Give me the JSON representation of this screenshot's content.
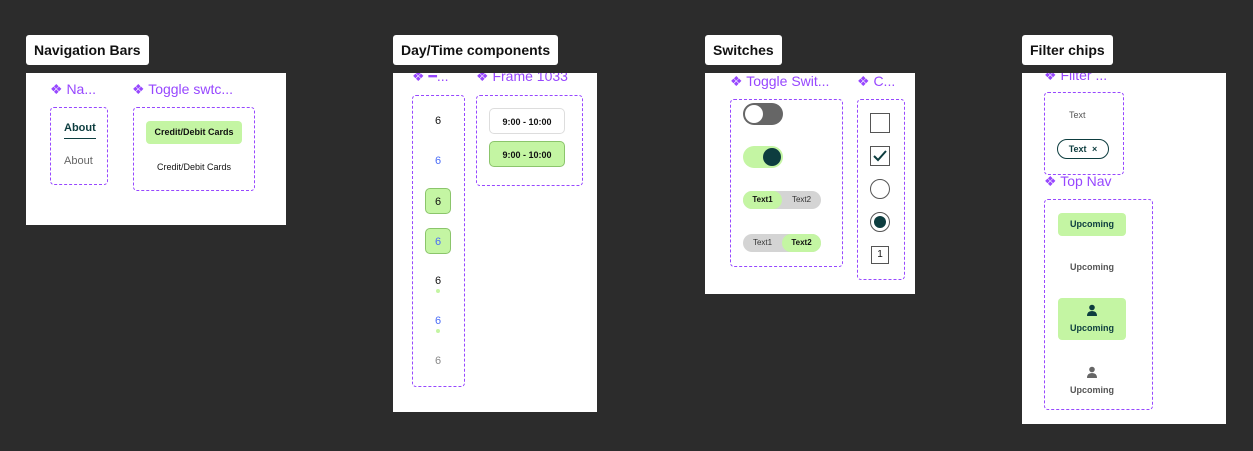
{
  "frames": {
    "navigation_bars": {
      "label": "Navigation Bars",
      "nav_component_title": "❖ Na...",
      "toggle_component_title": "❖ Toggle swtc...",
      "nav_active": "About",
      "nav_inactive": "About",
      "toggle_active": "Credit/Debit Cards",
      "toggle_inactive": "Credit/Debit Cards"
    },
    "day_time": {
      "label": "Day/Time components",
      "day_component_title": "❖ ━...",
      "time_component_title": "❖ Frame 1033",
      "days": [
        "6",
        "6",
        "6",
        "6",
        "6",
        "6",
        "6"
      ],
      "time_default": "9:00 - 10:00",
      "time_selected": "9:00 - 10:00"
    },
    "switches": {
      "label": "Switches",
      "toggle_component_title": "❖ Toggle Swit...",
      "check_component_title": "❖ C...",
      "segment_1": {
        "left": "Text1",
        "right": "Text2"
      },
      "segment_2": {
        "left": "Text1",
        "right": "Text2"
      },
      "number_box": "1"
    },
    "filter_chips": {
      "label": "Filter chips",
      "filter_component_title": "❖ Filter ...",
      "chip_default": "Text",
      "chip_selected": "Text",
      "chip_close": "×",
      "top_nav_title": "❖ Top Nav",
      "top_nav_items": [
        "Upcoming",
        "Upcoming",
        "Upcoming",
        "Upcoming"
      ]
    }
  },
  "colors": {
    "accent_purple": "#9747ff",
    "selected_green": "#c4f5a3",
    "dark_teal": "#0d3d3f",
    "canvas": "#2c2c2c"
  },
  "icons": [
    "checkmark-icon",
    "person-icon",
    "close-icon"
  ]
}
